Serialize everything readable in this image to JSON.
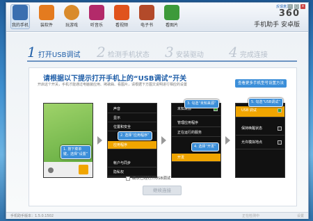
{
  "nav": [
    {
      "label": "我的手机",
      "color": "#3a6fb0"
    },
    {
      "label": "装软件",
      "color": "#e47b1f"
    },
    {
      "label": "玩游戏",
      "color": "#d98b2b"
    },
    {
      "label": "听音乐",
      "color": "#b32a6a"
    },
    {
      "label": "看视频",
      "color": "#e0531d"
    },
    {
      "label": "电子书",
      "color": "#b34a2a"
    },
    {
      "label": "看图片",
      "color": "#3d9a3a"
    }
  ],
  "brand": {
    "name": "360",
    "product": "手机助手 安卓版",
    "link": "反馈意见"
  },
  "steps": [
    {
      "num": "1",
      "label": "打开USB调试"
    },
    {
      "num": "2",
      "label": "检测手机状态"
    },
    {
      "num": "3",
      "label": "安装驱动"
    },
    {
      "num": "4",
      "label": "完成连接"
    }
  ],
  "title": "请根据以下提示打开手机上的“USB调试”开关",
  "subtitle": "开启这个开关，手机才能通过电脑装应用、拷歌曲、看图片，请根据下方图文说明进行相应的设置",
  "help_button": "查看更多手机型号设置方法",
  "phone1": {
    "bubble": "1. 按下菜单键，选择“设置”"
  },
  "phone2": {
    "items": [
      "声音",
      "显示",
      "位置和安全",
      "应用程序",
      "帐户与同步",
      "隐私权"
    ],
    "bubble": "2. 选择“应用程序”"
  },
  "phone3": {
    "items": [
      "未知来源",
      "管理应用程序",
      "正在运行的服务",
      "开发"
    ],
    "bubble": "3. 勾选“未知来源”",
    "bubble2": "4. 选择“开发”"
  },
  "phone4": {
    "items": [
      "USB 调试",
      "保持唤醒状态",
      "允许模拟地点"
    ],
    "bubble": "5. 勾选“USB调试”"
  },
  "confirm_label": "确认已经打开USB调试",
  "next_button": "继续连接",
  "footer": {
    "version": "手机助手版本：1.5.0.1502",
    "middle": "正在检测中",
    "right": "设置"
  }
}
